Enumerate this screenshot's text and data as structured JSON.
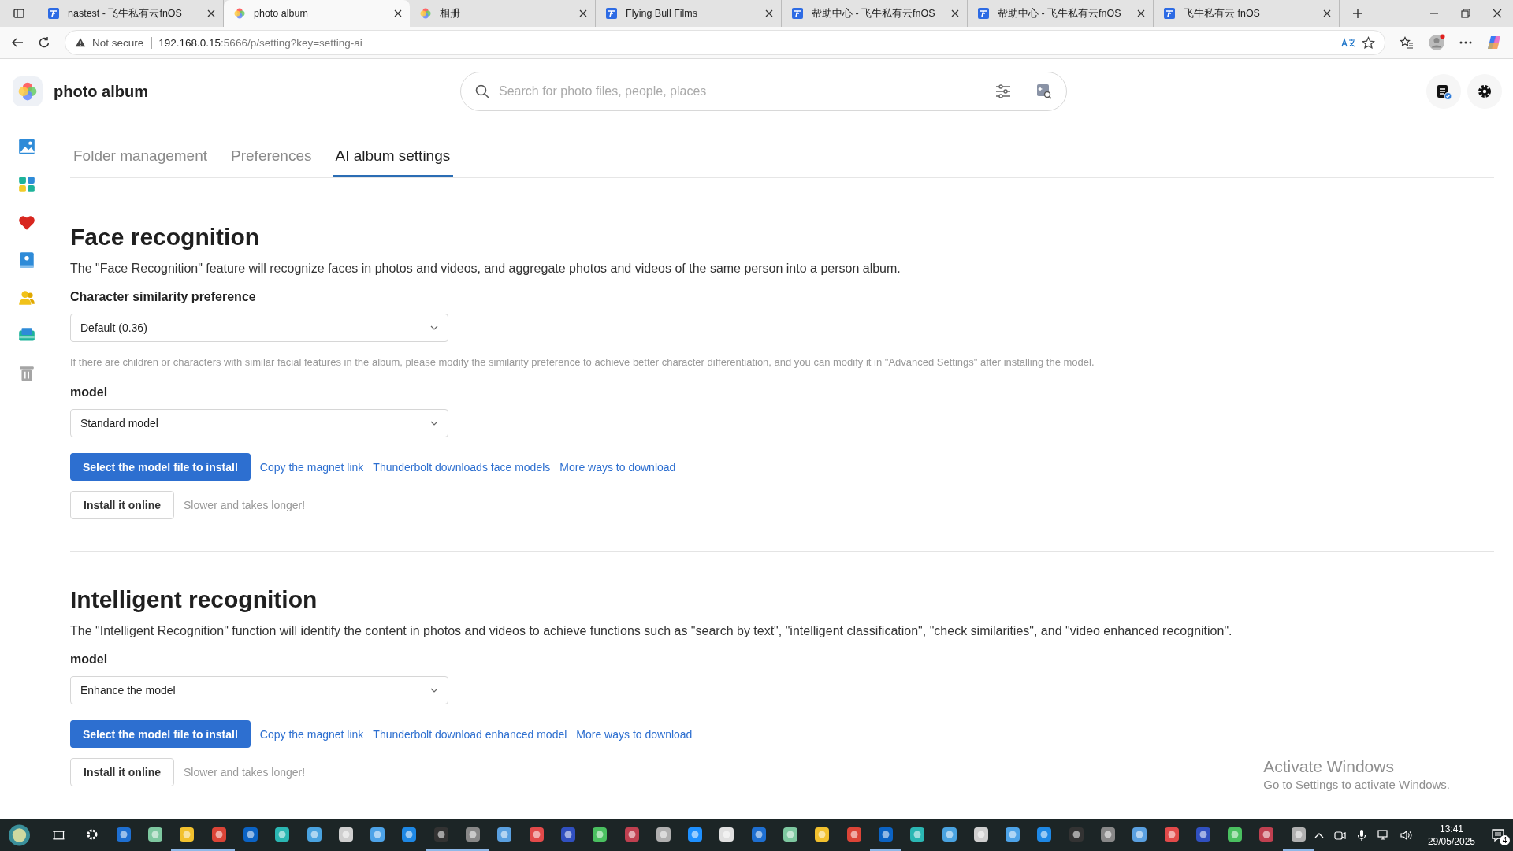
{
  "browser": {
    "tabs": [
      {
        "kind": "fnos",
        "title": "nastest - 飞牛私有云fnOS",
        "selected": false
      },
      {
        "kind": "album",
        "title": "photo album",
        "selected": true
      },
      {
        "kind": "album",
        "title": "相册",
        "selected": false
      },
      {
        "kind": "fnos",
        "title": "Flying Bull Films",
        "selected": false
      },
      {
        "kind": "fnos",
        "title": "帮助中心 - 飞牛私有云fnOS",
        "selected": false
      },
      {
        "kind": "fnos",
        "title": "帮助中心 - 飞牛私有云fnOS",
        "selected": false
      },
      {
        "kind": "fnos",
        "title": "飞牛私有云 fnOS",
        "selected": false
      }
    ],
    "security": "Not secure",
    "url_host": "192.168.0.15",
    "url_rest": ":5666/p/setting?key=setting-ai"
  },
  "app": {
    "title": "photo album",
    "search": {
      "placeholder": "Search for photo files, people, places"
    },
    "sidebar": [
      {
        "kind": "photos"
      },
      {
        "kind": "albums"
      },
      {
        "kind": "favorites"
      },
      {
        "kind": "book"
      },
      {
        "kind": "people"
      },
      {
        "kind": "gallery"
      },
      {
        "kind": "trash"
      }
    ],
    "tabs": [
      {
        "label": "Folder management",
        "selected": false
      },
      {
        "label": "Preferences",
        "selected": false
      },
      {
        "label": "AI album settings",
        "selected": true
      }
    ]
  },
  "sections": [
    {
      "title": "Face recognition",
      "description": "The \"Face Recognition\" feature will recognize faces in photos and videos, and aggregate photos and videos of the same person into a person album.",
      "fields": [
        {
          "label": "Character similarity preference",
          "value": "Default (0.36)",
          "hint": "If there are children or characters with similar facial features in the album, please modify the similarity preference to achieve better character differentiation, and you can modify it in \"Advanced Settings\" after installing the model."
        },
        {
          "label": "model",
          "value": "Standard model"
        }
      ],
      "primary_button": "Select the model file to install",
      "links": [
        "Copy the magnet link",
        "Thunderbolt downloads face models",
        "More ways to download"
      ],
      "secondary_button": "Install it online",
      "note": "Slower and takes longer!"
    },
    {
      "title": "Intelligent recognition",
      "description": "The \"Intelligent Recognition\" function will identify the content in photos and videos to achieve functions such as \"search by text\", \"intelligent classification\", \"check similarities\", and \"video enhanced recognition\".",
      "fields": [
        {
          "label": "model",
          "value": "Enhance the model"
        }
      ],
      "primary_button": "Select the model file to install",
      "links": [
        "Copy the magnet link",
        "Thunderbolt download enhanced model",
        "More ways to download"
      ],
      "secondary_button": "Install it online",
      "note": "Slower and takes longer!"
    }
  ],
  "activation": {
    "title": "Activate Windows",
    "subtitle": "Go to Settings to activate Windows."
  },
  "taskbar": {
    "apps": [
      {
        "running": false
      },
      {
        "running": false
      },
      {
        "running": false
      },
      {
        "running": true
      },
      {
        "running": true
      },
      {
        "running": false
      },
      {
        "running": false
      },
      {
        "running": false
      },
      {
        "running": false
      },
      {
        "running": false
      },
      {
        "running": false
      },
      {
        "running": true
      },
      {
        "running": true
      },
      {
        "running": false
      },
      {
        "running": false
      },
      {
        "running": false
      },
      {
        "running": false
      },
      {
        "running": false
      },
      {
        "running": false
      },
      {
        "running": false
      },
      {
        "running": false
      },
      {
        "running": false
      },
      {
        "running": false
      },
      {
        "running": false
      },
      {
        "running": false
      },
      {
        "running": true
      },
      {
        "running": false
      },
      {
        "running": false
      },
      {
        "running": false
      },
      {
        "running": false
      },
      {
        "running": false
      },
      {
        "running": false
      },
      {
        "running": false
      },
      {
        "running": false
      },
      {
        "running": false
      },
      {
        "running": false
      },
      {
        "running": false
      },
      {
        "running": false
      },
      {
        "running": true
      }
    ],
    "time": "13:41",
    "date": "29/05/2025",
    "notifications": "4"
  }
}
